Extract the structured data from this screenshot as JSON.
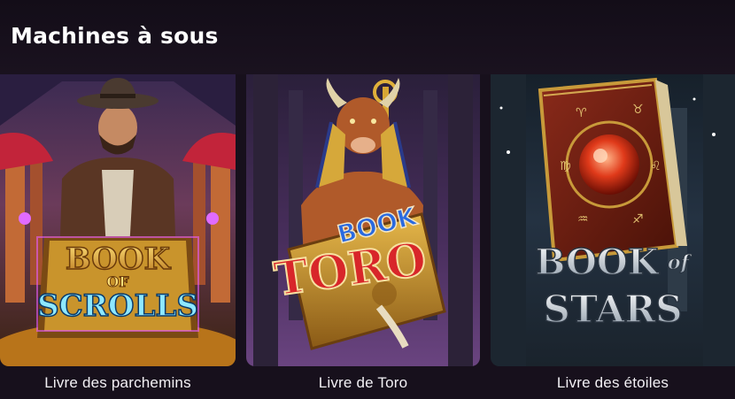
{
  "section": {
    "title": "Machines à sous"
  },
  "games": [
    {
      "label": "Livre des parchemins",
      "art_title_lines": [
        "BOOK",
        "OF",
        "SCROLLS"
      ],
      "accent": "#f2b431"
    },
    {
      "label": "Livre de Toro",
      "art_title_lines": [
        "BOOK",
        "TORO"
      ],
      "accent": "#d8262a"
    },
    {
      "label": "Livre des étoiles",
      "art_title_lines": [
        "BOOK",
        "of",
        "STARS"
      ],
      "accent": "#c9d3dc"
    }
  ],
  "colors": {
    "background": "#17101c",
    "text": "#ffffff"
  }
}
